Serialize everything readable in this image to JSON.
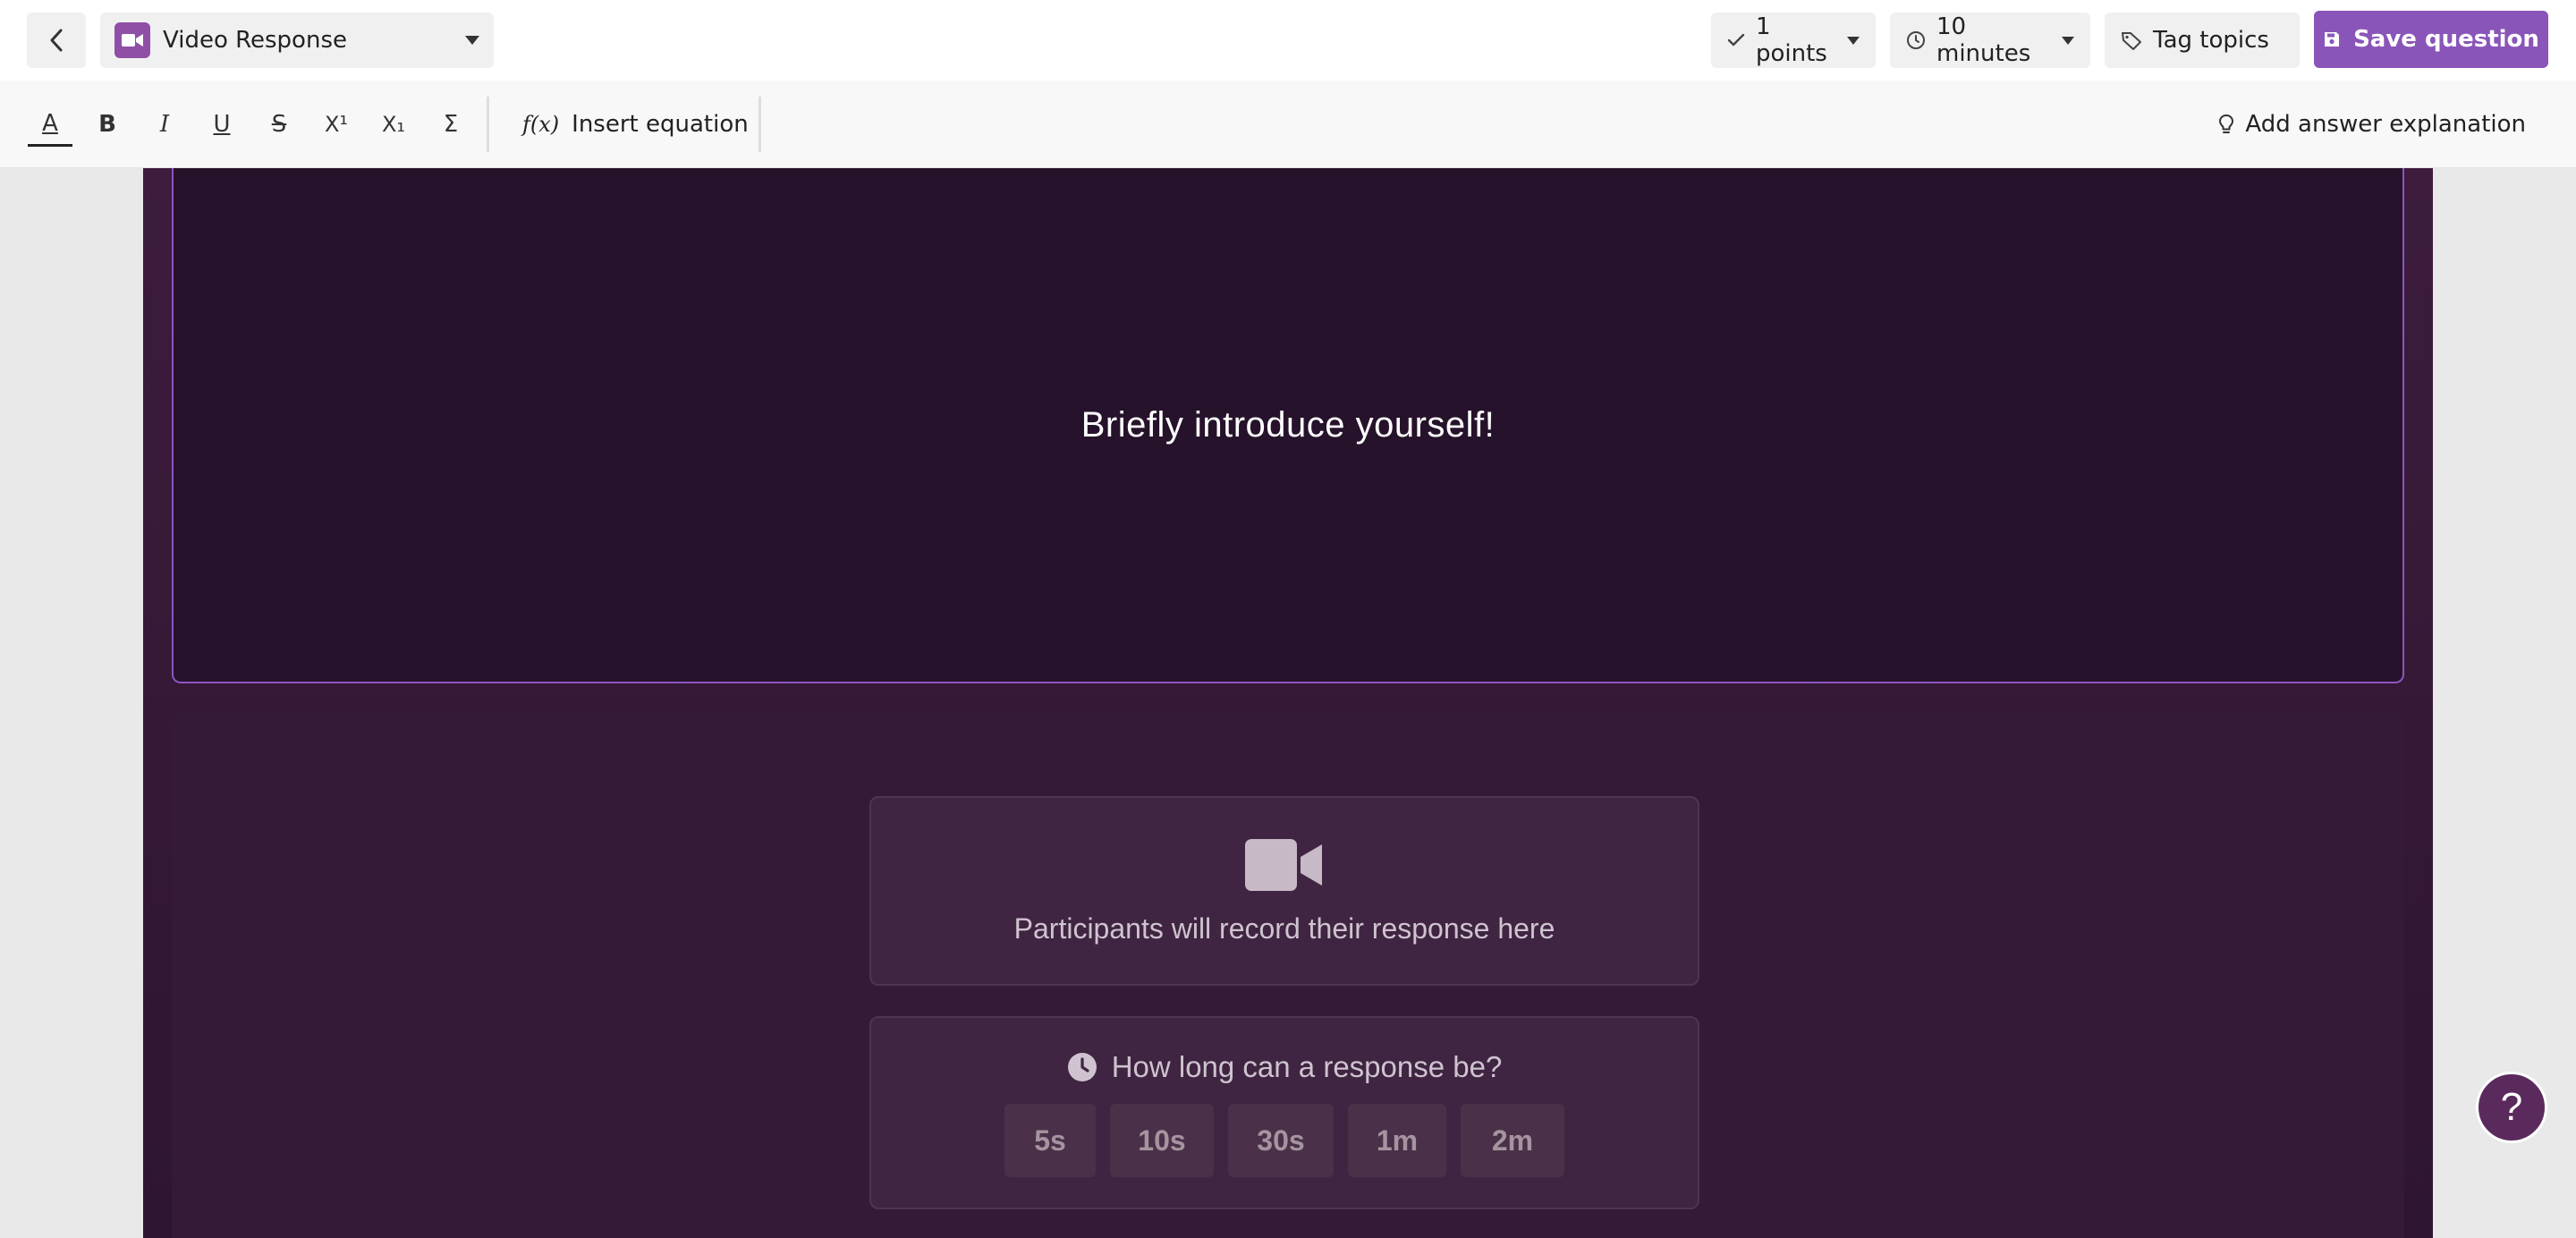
{
  "header": {
    "question_type": "Video Response",
    "points_label": "1 points",
    "time_label": "10 minutes",
    "tag_label": "Tag topics",
    "save_label": "Save question"
  },
  "toolbar": {
    "insert_equation_label": "Insert equation",
    "add_explanation_label": "Add answer explanation",
    "format_tools": [
      {
        "name": "text-color",
        "glyph": "A"
      },
      {
        "name": "bold",
        "glyph": "B"
      },
      {
        "name": "italic",
        "glyph": "I"
      },
      {
        "name": "underline",
        "glyph": "U"
      },
      {
        "name": "strikethrough",
        "glyph": "S"
      },
      {
        "name": "superscript",
        "glyph": "X¹"
      },
      {
        "name": "subscript",
        "glyph": "X₁"
      },
      {
        "name": "sigma",
        "glyph": "Σ"
      }
    ]
  },
  "question": {
    "text": "Briefly introduce yourself!"
  },
  "response": {
    "record_text": "Participants will record their response here",
    "duration_question": "How long can a response be?",
    "duration_options": [
      "5s",
      "10s",
      "30s",
      "1m",
      "2m"
    ]
  },
  "help": {
    "label": "?"
  },
  "colors": {
    "accent": "#8a55b9",
    "canvas_bg": "#3d1c3d",
    "question_bg": "#26122a"
  }
}
